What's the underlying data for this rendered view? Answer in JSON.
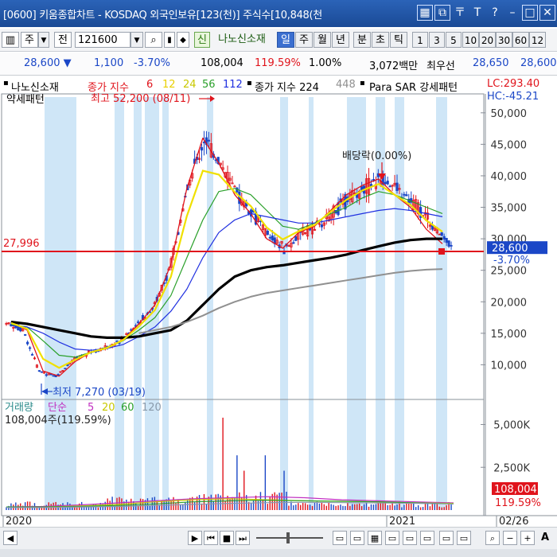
{
  "window": {
    "title": "[0600] 키움종합차트 - KOSDAQ 외국인보유[123(천)] 주식수[10,848(천"
  },
  "toolbar": {
    "code": "121600",
    "name": "나노신소재",
    "new_badge": "신",
    "kind_label": "주",
    "prev_label": "전",
    "periods": [
      "일",
      "주",
      "월",
      "년",
      "분",
      "초",
      "틱"
    ],
    "selected_period": "일",
    "intervals": [
      "1",
      "3",
      "5",
      "10",
      "20",
      "30",
      "60",
      "12"
    ]
  },
  "pricebar": {
    "price": "28,600",
    "change": "1,100",
    "change_pct": "-3.70%",
    "volume": "108,004",
    "volume_ratio": "119.59%",
    "rate": "1.00%",
    "amount": "3,072백만",
    "best_ask_label": "최우선",
    "ask": "28,650",
    "bid": "28,600"
  },
  "legend": {
    "name": "나노신소재",
    "ma_label": "종가 지수",
    "ma_periods": [
      "6",
      "12",
      "24",
      "56",
      "112"
    ],
    "long_ma_label": "종가 지수 224",
    "long_ma2": "448",
    "sar_label": "Para SAR 강세패턴",
    "second_line": "약세패턴",
    "lc": "LC:293.40",
    "hc": "HC:-45.21"
  },
  "annotations": {
    "high": "최고 52,200 (08/11)",
    "low": "최저 7,270 (03/19)",
    "dividend": "배당락(0.00%)",
    "hline_value": "27,996",
    "price_tag": "28,600",
    "price_tag_pct": "-3.70%"
  },
  "volume_legend": {
    "label": "거래량",
    "ma_label": "단순",
    "periods": [
      "5",
      "20",
      "60",
      "120"
    ],
    "value": "108,004주(119.59%)",
    "tag": "108,004",
    "tag_pct": "119.59%"
  },
  "axis": {
    "x_labels": [
      "2020",
      "2021",
      "02/26"
    ],
    "y_ticks": [
      "50,000",
      "45,000",
      "40,000",
      "35,000",
      "30,000",
      "25,000",
      "20,000",
      "15,000",
      "10,000"
    ],
    "vol_ticks": [
      "5,000K",
      "2,500K"
    ]
  },
  "colors": {
    "up": "#e0141c",
    "down": "#1b47c7",
    "ma6": "#e0141c",
    "ma12": "#f0e000",
    "ma24": "#d8d800",
    "ma56": "#2aa02a",
    "ma112": "#2030e0",
    "ma224": "#000000",
    "ma448": "#909090",
    "shade": "#cfe6f7"
  },
  "chart_data": {
    "type": "line",
    "title": "나노신소재",
    "x_range": [
      "2020-01",
      "2021-02-26"
    ],
    "ylim": [
      5000,
      52500
    ],
    "series": [
      {
        "name": "종가 지수 6",
        "values": [
          16800,
          15500,
          9000,
          8200,
          10500,
          12000,
          12600,
          14000,
          16500,
          19500,
          26000,
          38000,
          46000,
          42000,
          37000,
          34000,
          30000,
          28500,
          31000,
          32000,
          34500,
          37000,
          38500,
          39500,
          37000,
          35000,
          31500,
          29200
        ]
      },
      {
        "name": "56",
        "values": [
          16400,
          16000,
          13800,
          11500,
          11200,
          12000,
          12800,
          13800,
          15500,
          17500,
          21000,
          27000,
          33000,
          37500,
          38000,
          37000,
          34500,
          32000,
          31500,
          32500,
          34000,
          35000,
          36500,
          37500,
          37000,
          36000,
          35000,
          34000
        ]
      },
      {
        "name": "112",
        "values": [
          16200,
          16000,
          15000,
          13600,
          12500,
          12300,
          12600,
          13200,
          14500,
          16000,
          18500,
          22000,
          27000,
          31000,
          33000,
          34000,
          33500,
          33000,
          32500,
          32500,
          33000,
          33500,
          34000,
          34500,
          34800,
          34500,
          34000,
          33500
        ]
      },
      {
        "name": "종가 지수 224",
        "values": [
          16800,
          16500,
          16000,
          15500,
          15000,
          14500,
          14300,
          14300,
          14500,
          15000,
          15500,
          17000,
          19500,
          22000,
          24000,
          25000,
          25500,
          25800,
          26200,
          26600,
          27000,
          27500,
          28200,
          28800,
          29400,
          29800,
          30000,
          30000
        ]
      },
      {
        "name": "448",
        "values": [
          null,
          null,
          null,
          null,
          null,
          null,
          null,
          null,
          15000,
          15500,
          16000,
          16800,
          17800,
          19000,
          20000,
          20800,
          21400,
          21800,
          22200,
          22600,
          23000,
          23400,
          23800,
          24200,
          24600,
          24900,
          25100,
          25200
        ]
      }
    ],
    "hline": 27996,
    "high": {
      "value": 52200,
      "date": "08/11"
    },
    "low": {
      "value": 7270,
      "date": "03/19"
    },
    "volume_series": {
      "name": "거래량",
      "ylim": [
        0,
        6000000
      ]
    }
  }
}
